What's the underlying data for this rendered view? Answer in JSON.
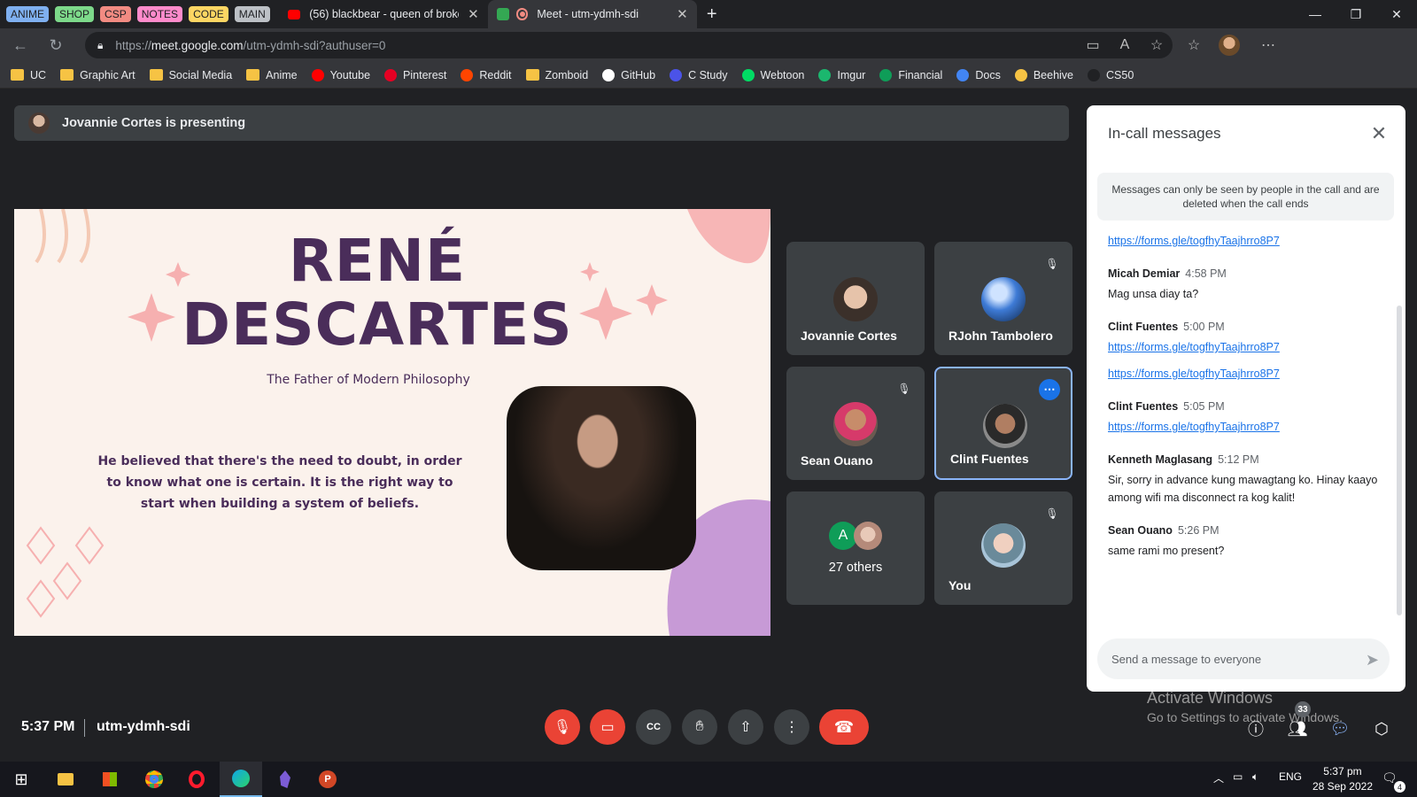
{
  "browser": {
    "tab_groups": [
      {
        "label": "ANIME",
        "color": "#7fb0f0"
      },
      {
        "label": "SHOP",
        "color": "#7dd98a"
      },
      {
        "label": "CSP",
        "color": "#f28b82"
      },
      {
        "label": "NOTES",
        "color": "#ff8bcb"
      },
      {
        "label": "CODE",
        "color": "#fdd663"
      },
      {
        "label": "MAIN",
        "color": "#bdc1c6"
      }
    ],
    "tabs": [
      {
        "title": "(56) blackbear - queen of broken",
        "icon": "youtube-icon"
      },
      {
        "title": "Meet - utm-ydmh-sdi",
        "icon": "meet-icon"
      }
    ],
    "url_prefix": "https://",
    "url_host": "meet.google.com",
    "url_path": "/utm-ydmh-sdi?authuser=0",
    "bookmarks": [
      {
        "label": "UC",
        "icon": "folder"
      },
      {
        "label": "Graphic Art",
        "icon": "folder"
      },
      {
        "label": "Social Media",
        "icon": "folder"
      },
      {
        "label": "Anime",
        "icon": "folder"
      },
      {
        "label": "Youtube",
        "icon": "youtube"
      },
      {
        "label": "Pinterest",
        "icon": "pinterest"
      },
      {
        "label": "Reddit",
        "icon": "reddit"
      },
      {
        "label": "Zomboid",
        "icon": "folder"
      },
      {
        "label": "GitHub",
        "icon": "github"
      },
      {
        "label": "C Study",
        "icon": "cstudy"
      },
      {
        "label": "Webtoon",
        "icon": "webtoon"
      },
      {
        "label": "Imgur",
        "icon": "imgur"
      },
      {
        "label": "Financial",
        "icon": "financial"
      },
      {
        "label": "Docs",
        "icon": "docs"
      },
      {
        "label": "Beehive",
        "icon": "beehive"
      },
      {
        "label": "CS50",
        "icon": "cs50"
      }
    ]
  },
  "meet": {
    "presenting_banner": "Jovannie Cortes is presenting",
    "slide": {
      "title_line1": "RENÉ",
      "title_line2": "DESCARTES",
      "subtitle": "The Father of Modern Philosophy",
      "body": "He believed that there's the need to doubt, in order to know what one is certain. It is the right way to start when building a system of beliefs."
    },
    "participants": [
      {
        "name": "Jovannie Cortes",
        "muted": false
      },
      {
        "name": "RJohn Tambolero",
        "muted": true
      },
      {
        "name": "Sean Ouano",
        "muted": true
      },
      {
        "name": "Clint Fuentes",
        "muted": false
      },
      {
        "name": "27 others",
        "initial": "A"
      },
      {
        "name": "You",
        "muted": true
      }
    ],
    "chat": {
      "title": "In-call messages",
      "notice": "Messages can only be seen by people in the call and are deleted when the call ends",
      "messages": [
        {
          "sender": "",
          "time": "",
          "lines": [],
          "links": [
            "https://forms.gle/togfhyTaajhrro8P7"
          ]
        },
        {
          "sender": "Micah Demiar",
          "time": "4:58 PM",
          "lines": [
            "Mag unsa diay ta?"
          ],
          "links": []
        },
        {
          "sender": "Clint Fuentes",
          "time": "5:00 PM",
          "lines": [],
          "links": [
            "https://forms.gle/togfhyTaajhrro8P7",
            "https://forms.gle/togfhyTaajhrro8P7"
          ]
        },
        {
          "sender": "Clint Fuentes",
          "time": "5:05 PM",
          "lines": [],
          "links": [
            "https://forms.gle/togfhyTaajhrro8P7"
          ]
        },
        {
          "sender": "Kenneth Maglasang",
          "time": "5:12 PM",
          "lines": [
            "Sir, sorry in advance kung mawagtang ko. Hinay kaayo among wifi ma disconnect ra kog kalit!"
          ],
          "links": []
        },
        {
          "sender": "Sean Ouano",
          "time": "5:26 PM",
          "lines": [
            "same rami mo present?"
          ],
          "links": []
        }
      ],
      "input_placeholder": "Send a message to everyone"
    },
    "time": "5:37 PM",
    "meeting_code": "utm-ydmh-sdi",
    "people_count": "33",
    "watermark_line1": "Activate Windows",
    "watermark_line2": "Go to Settings to activate Windows."
  },
  "taskbar": {
    "time": "5:37 pm",
    "date": "28 Sep 2022",
    "lang": "ENG",
    "notifications": "4"
  }
}
